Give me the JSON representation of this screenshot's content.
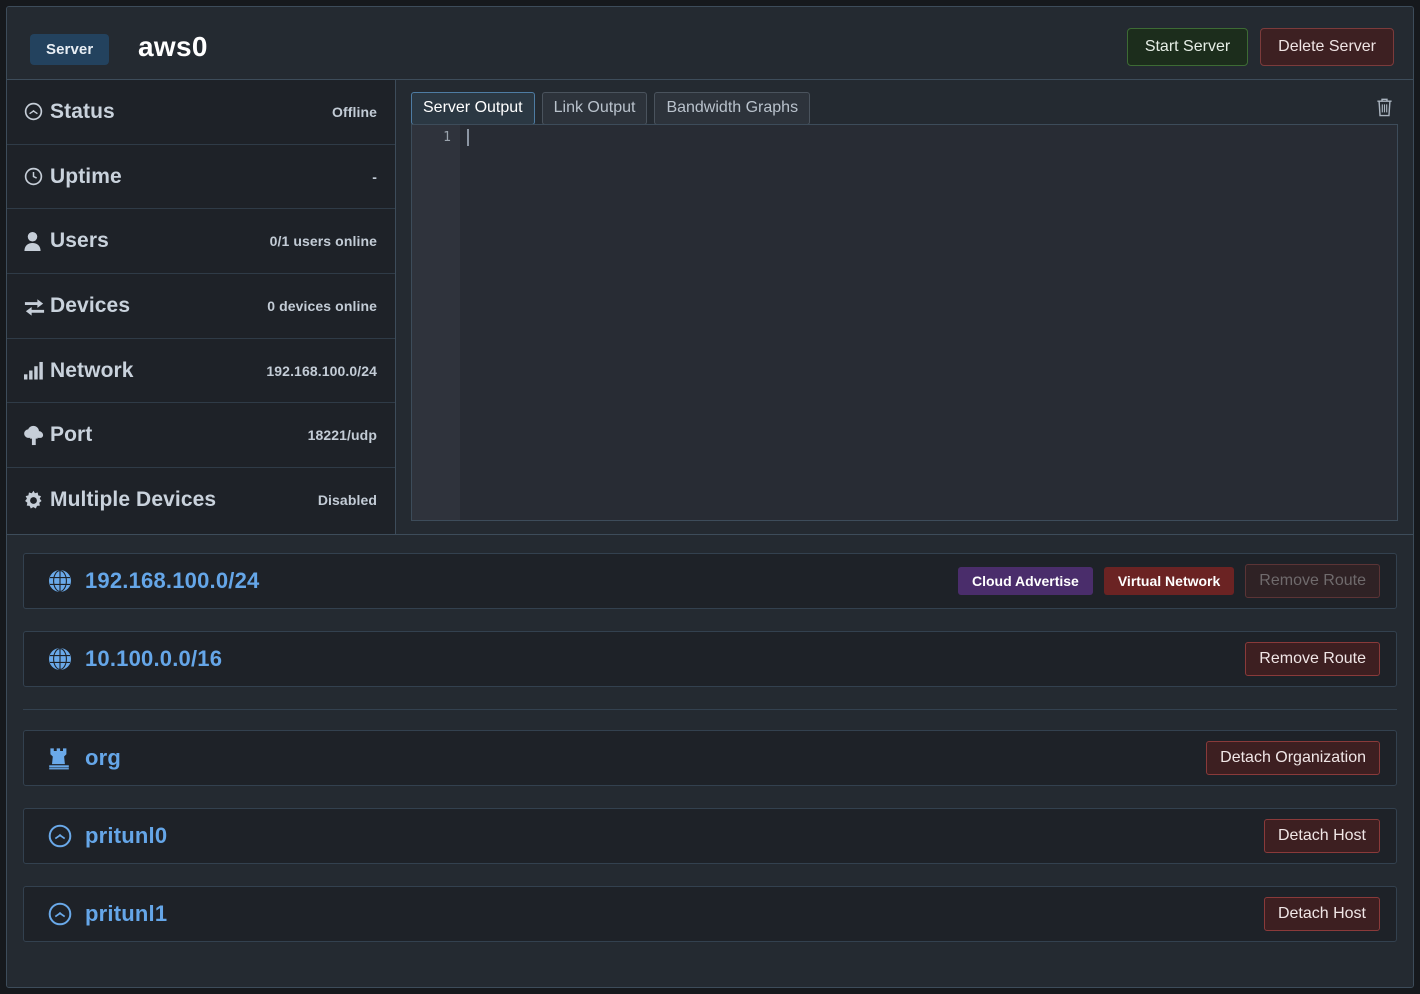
{
  "header": {
    "badge": "Server",
    "title": "aws0",
    "start_button": "Start Server",
    "delete_button": "Delete Server"
  },
  "status": {
    "rows": [
      {
        "icon": "gauge-icon",
        "label": "Status",
        "value": "Offline"
      },
      {
        "icon": "clock-icon",
        "label": "Uptime",
        "value": "-"
      },
      {
        "icon": "user-icon",
        "label": "Users",
        "value": "0/1 users online"
      },
      {
        "icon": "exchange-icon",
        "label": "Devices",
        "value": "0 devices online"
      },
      {
        "icon": "signal-bars-icon",
        "label": "Network",
        "value": "192.168.100.0/24"
      },
      {
        "icon": "cloud-upload-icon",
        "label": "Port",
        "value": "18221/udp"
      },
      {
        "icon": "gear-icon",
        "label": "Multiple Devices",
        "value": "Disabled"
      }
    ]
  },
  "output": {
    "tabs": [
      {
        "label": "Server Output",
        "active": true
      },
      {
        "label": "Link Output",
        "active": false
      },
      {
        "label": "Bandwidth Graphs",
        "active": false
      }
    ],
    "clear_icon": "trash-icon",
    "gutter_line": "1",
    "content": ""
  },
  "routes": [
    {
      "icon": "globe-icon",
      "name": "192.168.100.0/24",
      "pills": [
        {
          "label": "Cloud Advertise",
          "style": "purple",
          "color": "#4a2d6b"
        },
        {
          "label": "Virtual Network",
          "style": "maroon",
          "color": "#6b2323"
        }
      ],
      "action": "Remove Route",
      "action_disabled": true
    },
    {
      "icon": "globe-icon",
      "name": "10.100.0.0/16",
      "pills": [],
      "action": "Remove Route",
      "action_disabled": false
    }
  ],
  "organizations": [
    {
      "icon": "chess-rook-icon",
      "name": "org",
      "action": "Detach Organization"
    }
  ],
  "hosts": [
    {
      "icon": "gauge-icon",
      "name": "pritunl0",
      "action": "Detach Host"
    },
    {
      "icon": "gauge-icon",
      "name": "pritunl1",
      "action": "Detach Host"
    }
  ],
  "colors": {
    "accent_blue": "#65a6e8",
    "panel_bg": "#242a31",
    "row_bg": "#1e2228",
    "border": "#33414f",
    "badge_blue": "#23425e",
    "green_btn": "#1c2d1c",
    "red_btn": "#3d2022"
  }
}
